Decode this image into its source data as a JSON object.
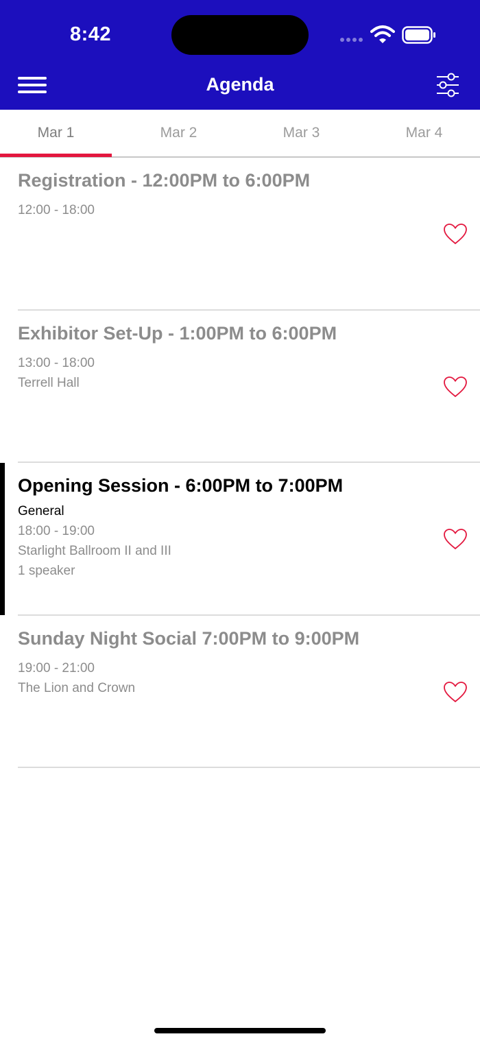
{
  "status_bar": {
    "time": "8:42"
  },
  "header": {
    "title": "Agenda",
    "menu_icon": "hamburger-menu-icon",
    "filter_icon": "filter-sliders-icon",
    "background": "#1c0fbd"
  },
  "tabs": [
    {
      "label": "Mar 1",
      "active": true
    },
    {
      "label": "Mar 2",
      "active": false
    },
    {
      "label": "Mar 3",
      "active": false
    },
    {
      "label": "Mar 4",
      "active": false
    }
  ],
  "accent_color": "#e3173e",
  "sessions": [
    {
      "title": "Registration - 12:00PM to 6:00PM",
      "track": "",
      "time": "12:00 - 18:00",
      "location": "",
      "speakers": "",
      "current": false
    },
    {
      "title": "Exhibitor Set-Up  - 1:00PM to 6:00PM",
      "track": "",
      "time": "13:00 - 18:00",
      "location": "Terrell Hall",
      "speakers": "",
      "current": false
    },
    {
      "title": "Opening Session - 6:00PM to 7:00PM",
      "track": "General",
      "time": "18:00 - 19:00",
      "location": "Starlight Ballroom II and III",
      "speakers": "1 speaker",
      "current": true
    },
    {
      "title": "Sunday Night Social 7:00PM to 9:00PM",
      "track": "",
      "time": "19:00 - 21:00",
      "location": "The Lion and Crown",
      "speakers": "",
      "current": false
    }
  ]
}
